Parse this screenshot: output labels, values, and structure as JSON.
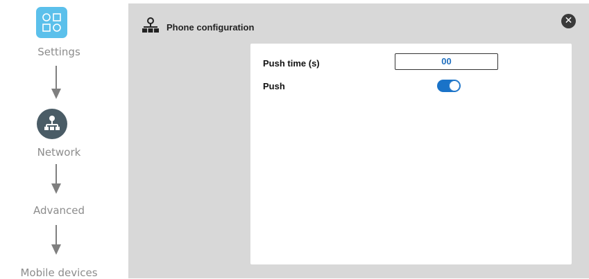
{
  "nav": {
    "steps": [
      {
        "label": "Settings",
        "icon": "settings-icon"
      },
      {
        "label": "Network",
        "icon": "network-icon"
      },
      {
        "label": "Advanced"
      },
      {
        "label": "Mobile devices"
      }
    ]
  },
  "dialog": {
    "title": "Phone configuration",
    "icon": "network-tree-icon",
    "close_icon": "close-icon",
    "fields": {
      "push_time": {
        "label": "Push time (s)",
        "value": "00"
      },
      "push": {
        "label": "Push",
        "enabled": true
      }
    }
  },
  "colors": {
    "accent": "#1a73c8",
    "settings_tile": "#5bc0eb",
    "network_circle": "#4a5c66",
    "panel_bg": "#d8d8d8"
  }
}
